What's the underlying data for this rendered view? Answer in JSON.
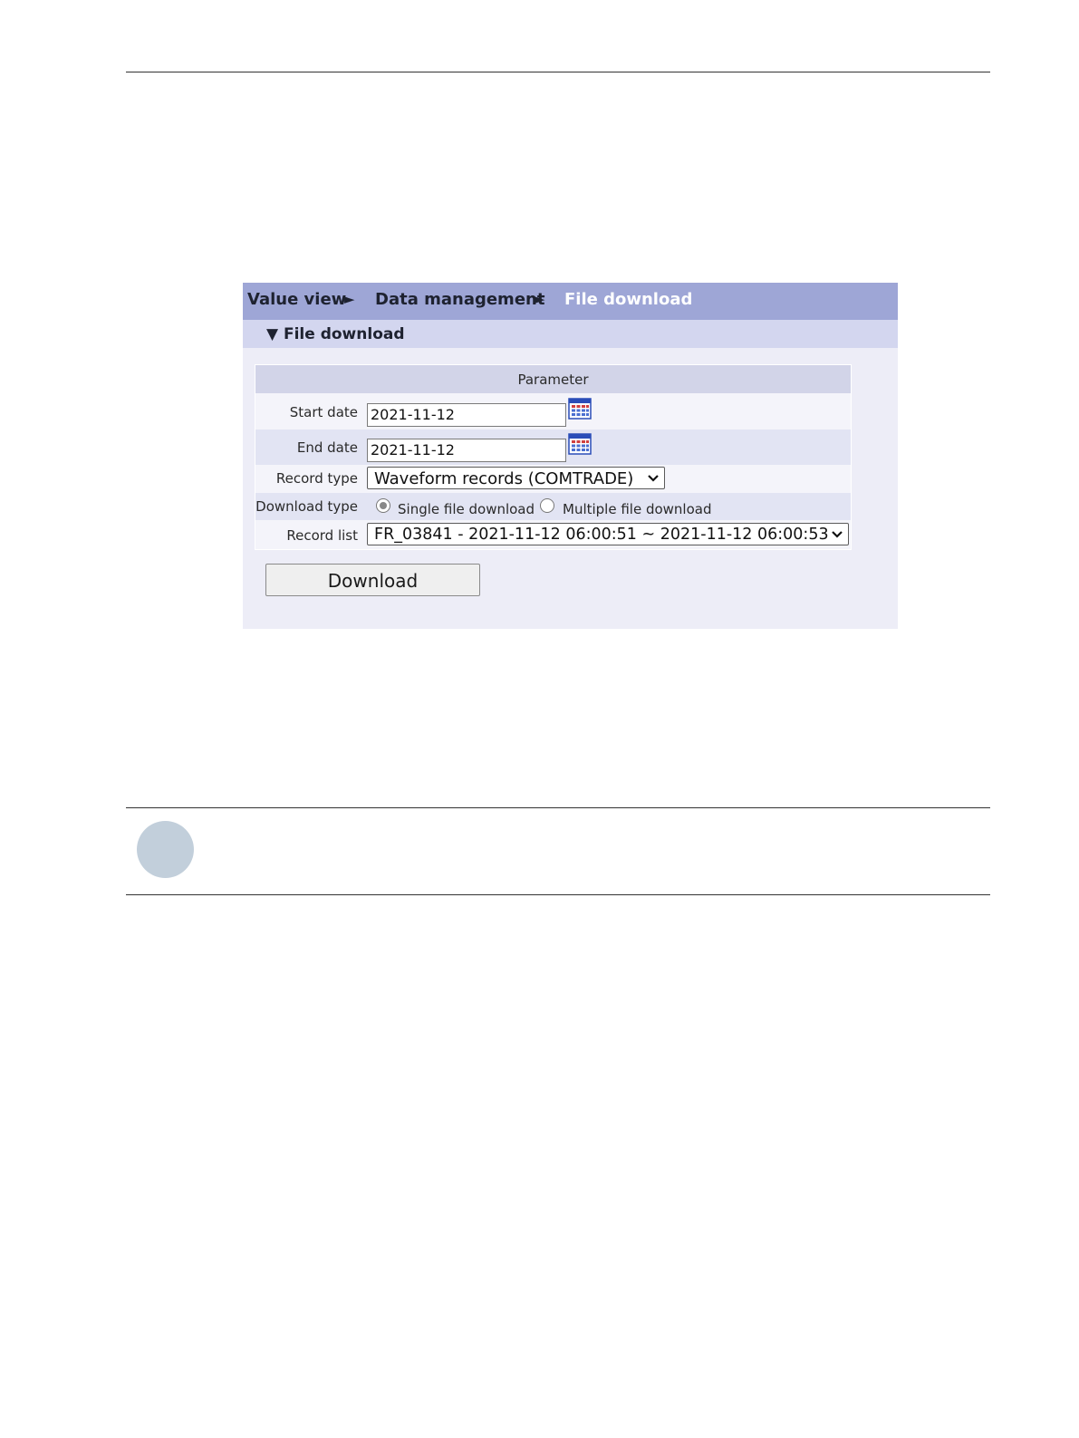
{
  "breadcrumb": {
    "items": [
      "Value view",
      "Data management",
      "File download"
    ],
    "separator": "►"
  },
  "section": {
    "title": "▼ File download"
  },
  "form": {
    "header": "Parameter",
    "start_date": {
      "label": "Start date",
      "value": "2021-11-12",
      "icon": "calendar-icon"
    },
    "end_date": {
      "label": "End date",
      "value": "2021-11-12",
      "icon": "calendar-icon"
    },
    "record_type": {
      "label": "Record type",
      "selected": "Waveform records (COMTRADE)"
    },
    "download_type": {
      "label": "Download type",
      "options": [
        "Single file download",
        "Multiple file download"
      ],
      "selected": "Single file download"
    },
    "record_list": {
      "label": "Record list",
      "selected": "FR_03841 - 2021-11-12 06:00:51 ~ 2021-11-12 06:00:53"
    }
  },
  "download_button": {
    "label": "Download"
  },
  "colors": {
    "breadcrumb_bar": "#9ea6d6",
    "section_bar": "#d3d6ef",
    "panel_bg": "#ededf7",
    "current_crumb": "#ffffff",
    "note_circle": "#c2cfdb"
  }
}
